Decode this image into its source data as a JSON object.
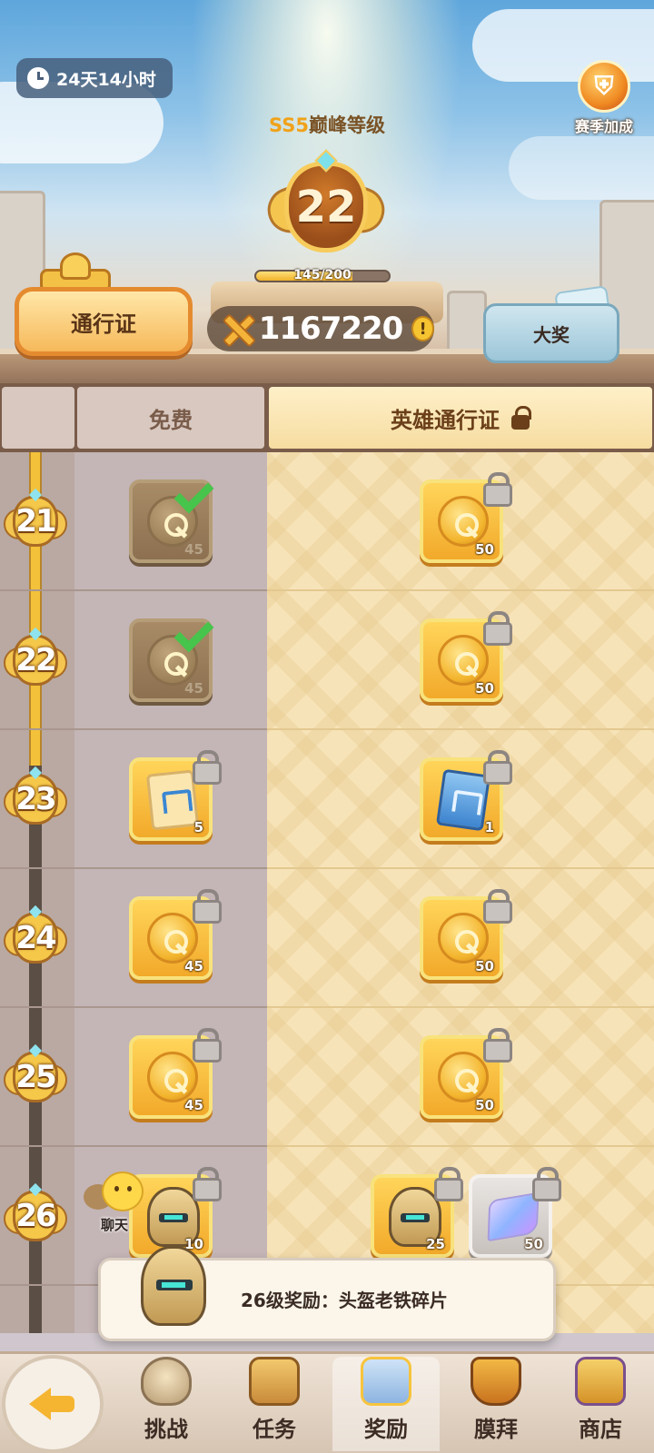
{
  "header": {
    "timer": "24天14小时",
    "season_bonus_label": "赛季加成",
    "rank_prefix": "SS5",
    "rank_suffix": "巅峰等级",
    "level": "22",
    "xp_text": "145/200",
    "xp_progress": 0.725,
    "pass_button": "通行证",
    "currency_value": "1167220",
    "info_glyph": "!",
    "grand_prize": "大奖"
  },
  "columns": {
    "free": "免费",
    "hero": "英雄通行证"
  },
  "rows": [
    {
      "level": "21",
      "free": {
        "icon": "coin-icon",
        "qty": "45",
        "state": "claimed"
      },
      "hero": [
        {
          "icon": "coin-icon",
          "qty": "50",
          "state": "locked"
        }
      ]
    },
    {
      "level": "22",
      "free": {
        "icon": "coin-icon",
        "qty": "45",
        "state": "claimed"
      },
      "hero": [
        {
          "icon": "coin-icon",
          "qty": "50",
          "state": "locked"
        }
      ]
    },
    {
      "level": "23",
      "free": {
        "icon": "ticket-icon",
        "qty": "5",
        "state": "locked"
      },
      "hero": [
        {
          "icon": "blue-ticket-icon",
          "qty": "1",
          "state": "locked"
        }
      ]
    },
    {
      "level": "24",
      "free": {
        "icon": "coin-icon",
        "qty": "45",
        "state": "locked"
      },
      "hero": [
        {
          "icon": "coin-icon",
          "qty": "50",
          "state": "locked"
        }
      ]
    },
    {
      "level": "25",
      "free": {
        "icon": "coin-icon",
        "qty": "45",
        "state": "locked"
      },
      "hero": [
        {
          "icon": "coin-icon",
          "qty": "50",
          "state": "locked"
        }
      ]
    },
    {
      "level": "26",
      "free": {
        "icon": "helmet-icon",
        "qty": "10",
        "state": "locked"
      },
      "hero": [
        {
          "icon": "helmet-icon",
          "qty": "25",
          "state": "locked"
        },
        {
          "icon": "crystal-icon",
          "qty": "50",
          "state": "locked"
        }
      ]
    }
  ],
  "chat_label": "聊天",
  "tooltip_text": "26级奖励：头盔老铁碎片",
  "nav": {
    "tabs": [
      "挑战",
      "任务",
      "奖励",
      "膜拜",
      "商店"
    ],
    "active": "奖励"
  }
}
